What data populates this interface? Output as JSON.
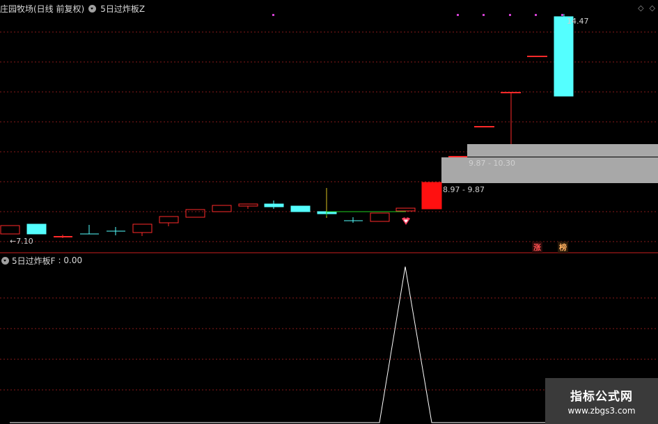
{
  "header": {
    "title": "庄园牧场(日线 前复权)",
    "indicator": "5日过炸板Z",
    "price_high": "14.47",
    "price_low": "←7.10",
    "zone_upper": "9.87 - 10.30",
    "zone_lower": "8.97 - 9.87",
    "badge_1": "涨",
    "badge_2": "榜"
  },
  "subpanel": {
    "indicator": "5日过炸板F",
    "value": ": 0.00"
  },
  "watermark": {
    "name": "指标公式网",
    "url": "www.zbgs3.com"
  },
  "colors": {
    "background": "#000000",
    "up": "#ff2a2a",
    "down": "#54ffff",
    "grid": "#8a1a1a",
    "zone": "#a8a8a8",
    "line": "#ffffff",
    "divider": "#c81e1e"
  },
  "icons": [
    "chevron-down-icon",
    "diamond-icon"
  ]
}
